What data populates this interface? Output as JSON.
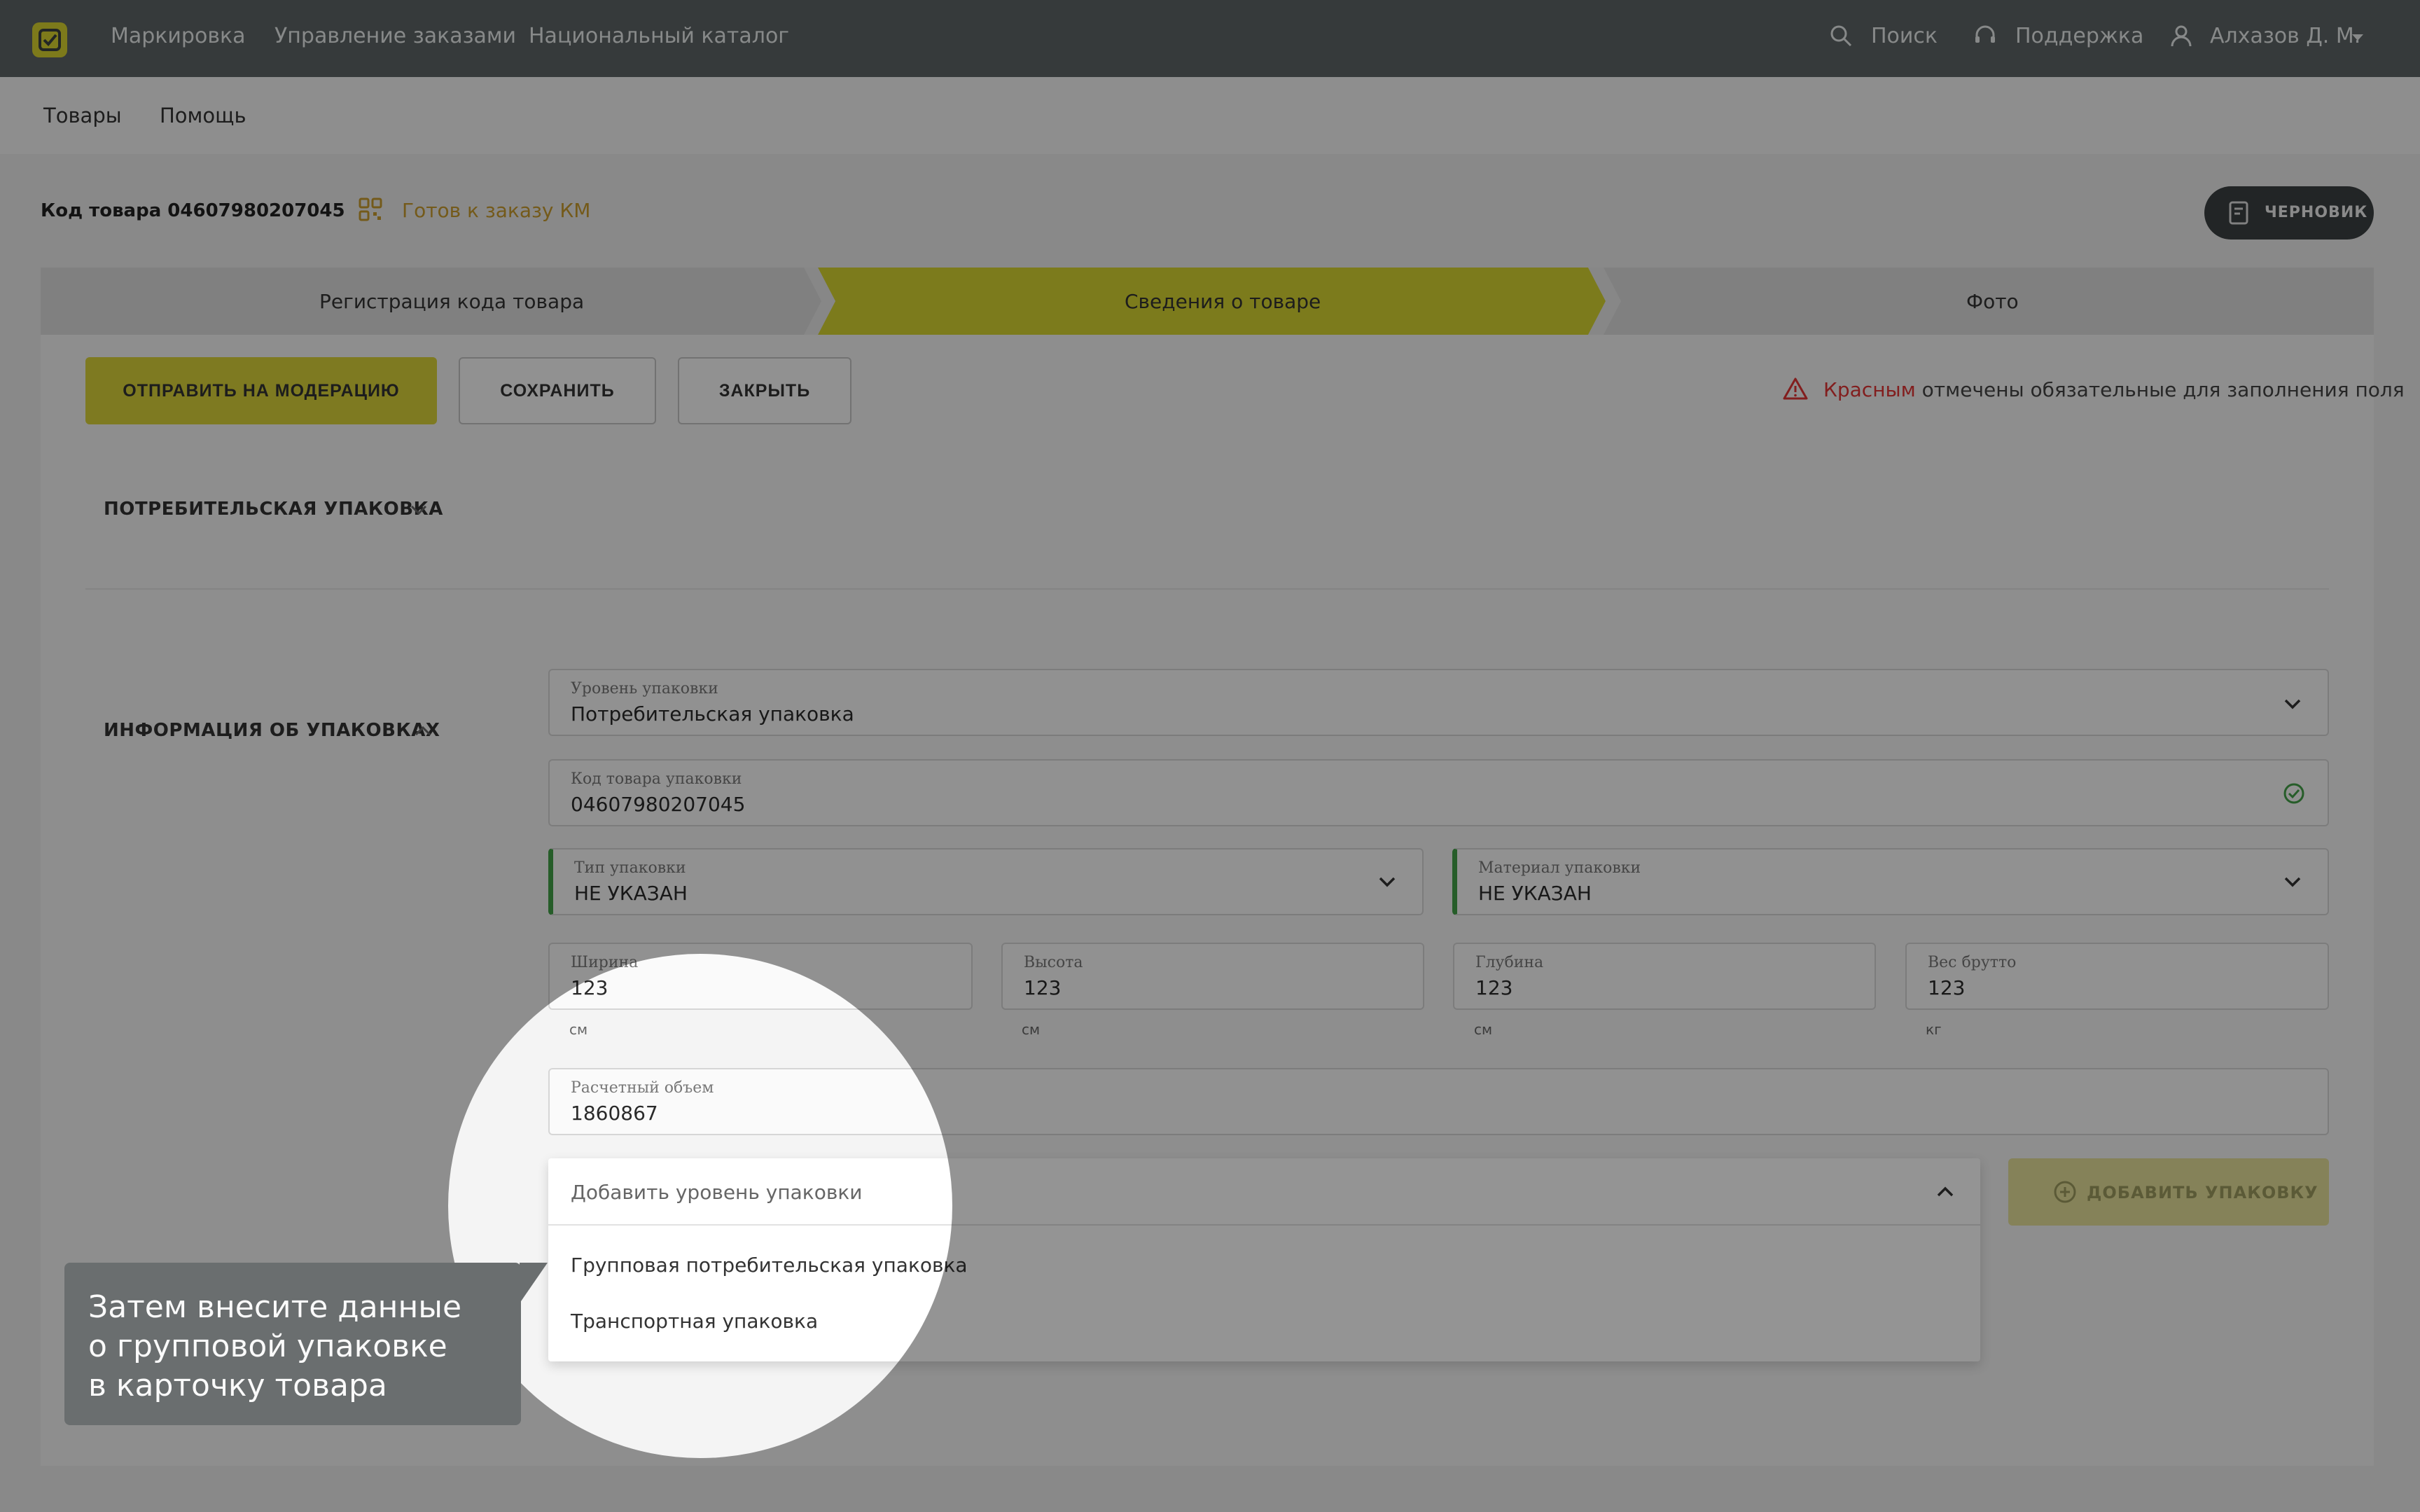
{
  "topnav": {
    "items": [
      "Маркировка",
      "Управление заказами",
      "Национальный каталог"
    ],
    "search": "Поиск",
    "support": "Поддержка",
    "user": "Алхазов Д. М."
  },
  "subnav": {
    "items": [
      "Товары",
      "Помощь"
    ]
  },
  "product": {
    "code_label": "Код товара 04607980207045",
    "status": "Готов к заказу КМ",
    "draft": "ЧЕРНОВИК"
  },
  "steps": [
    "Регистрация кода товара",
    "Сведения о товаре",
    "Фото"
  ],
  "actions": {
    "submit": "ОТПРАВИТЬ НА МОДЕРАЦИЮ",
    "save": "СОХРАНИТЬ",
    "close": "ЗАКРЫТЬ"
  },
  "required_note": {
    "red_word": "Красным",
    "rest": " отмечены обязательные для заполнения поля"
  },
  "sections": {
    "consumer_pack": "ПОТРЕБИТЕЛЬСКАЯ УПАКОВКА",
    "pack_info": "ИНФОРМАЦИЯ ОБ УПАКОВКАХ"
  },
  "fields": {
    "level": {
      "label": "Уровень упаковки",
      "value": "Потребительская упаковка"
    },
    "code": {
      "label": "Код товара упаковки",
      "value": "04607980207045"
    },
    "type": {
      "label": "Тип упаковки",
      "value": "НЕ УКАЗАН"
    },
    "material": {
      "label": "Материал упаковки",
      "value": "НЕ УКАЗАН"
    },
    "width": {
      "label": "Ширина",
      "value": "123",
      "unit": "см"
    },
    "height": {
      "label": "Высота",
      "value": "123",
      "unit": "см"
    },
    "depth": {
      "label": "Глубина",
      "value": "123",
      "unit": "см"
    },
    "weight": {
      "label": "Вес брутто",
      "value": "123",
      "unit": "кг"
    },
    "volume": {
      "label": "Расчетный объем",
      "value": "1860867"
    }
  },
  "add_level": {
    "placeholder": "Добавить уровень упаковки",
    "options": [
      "Групповая потребительская упаковка",
      "Транспортная упаковка"
    ]
  },
  "add_package": "ДОБАВИТЬ УПАКОВКУ",
  "callout": {
    "lines": [
      "Затем внесите данные",
      "о групповой упаковке",
      "в карточку товара"
    ]
  }
}
